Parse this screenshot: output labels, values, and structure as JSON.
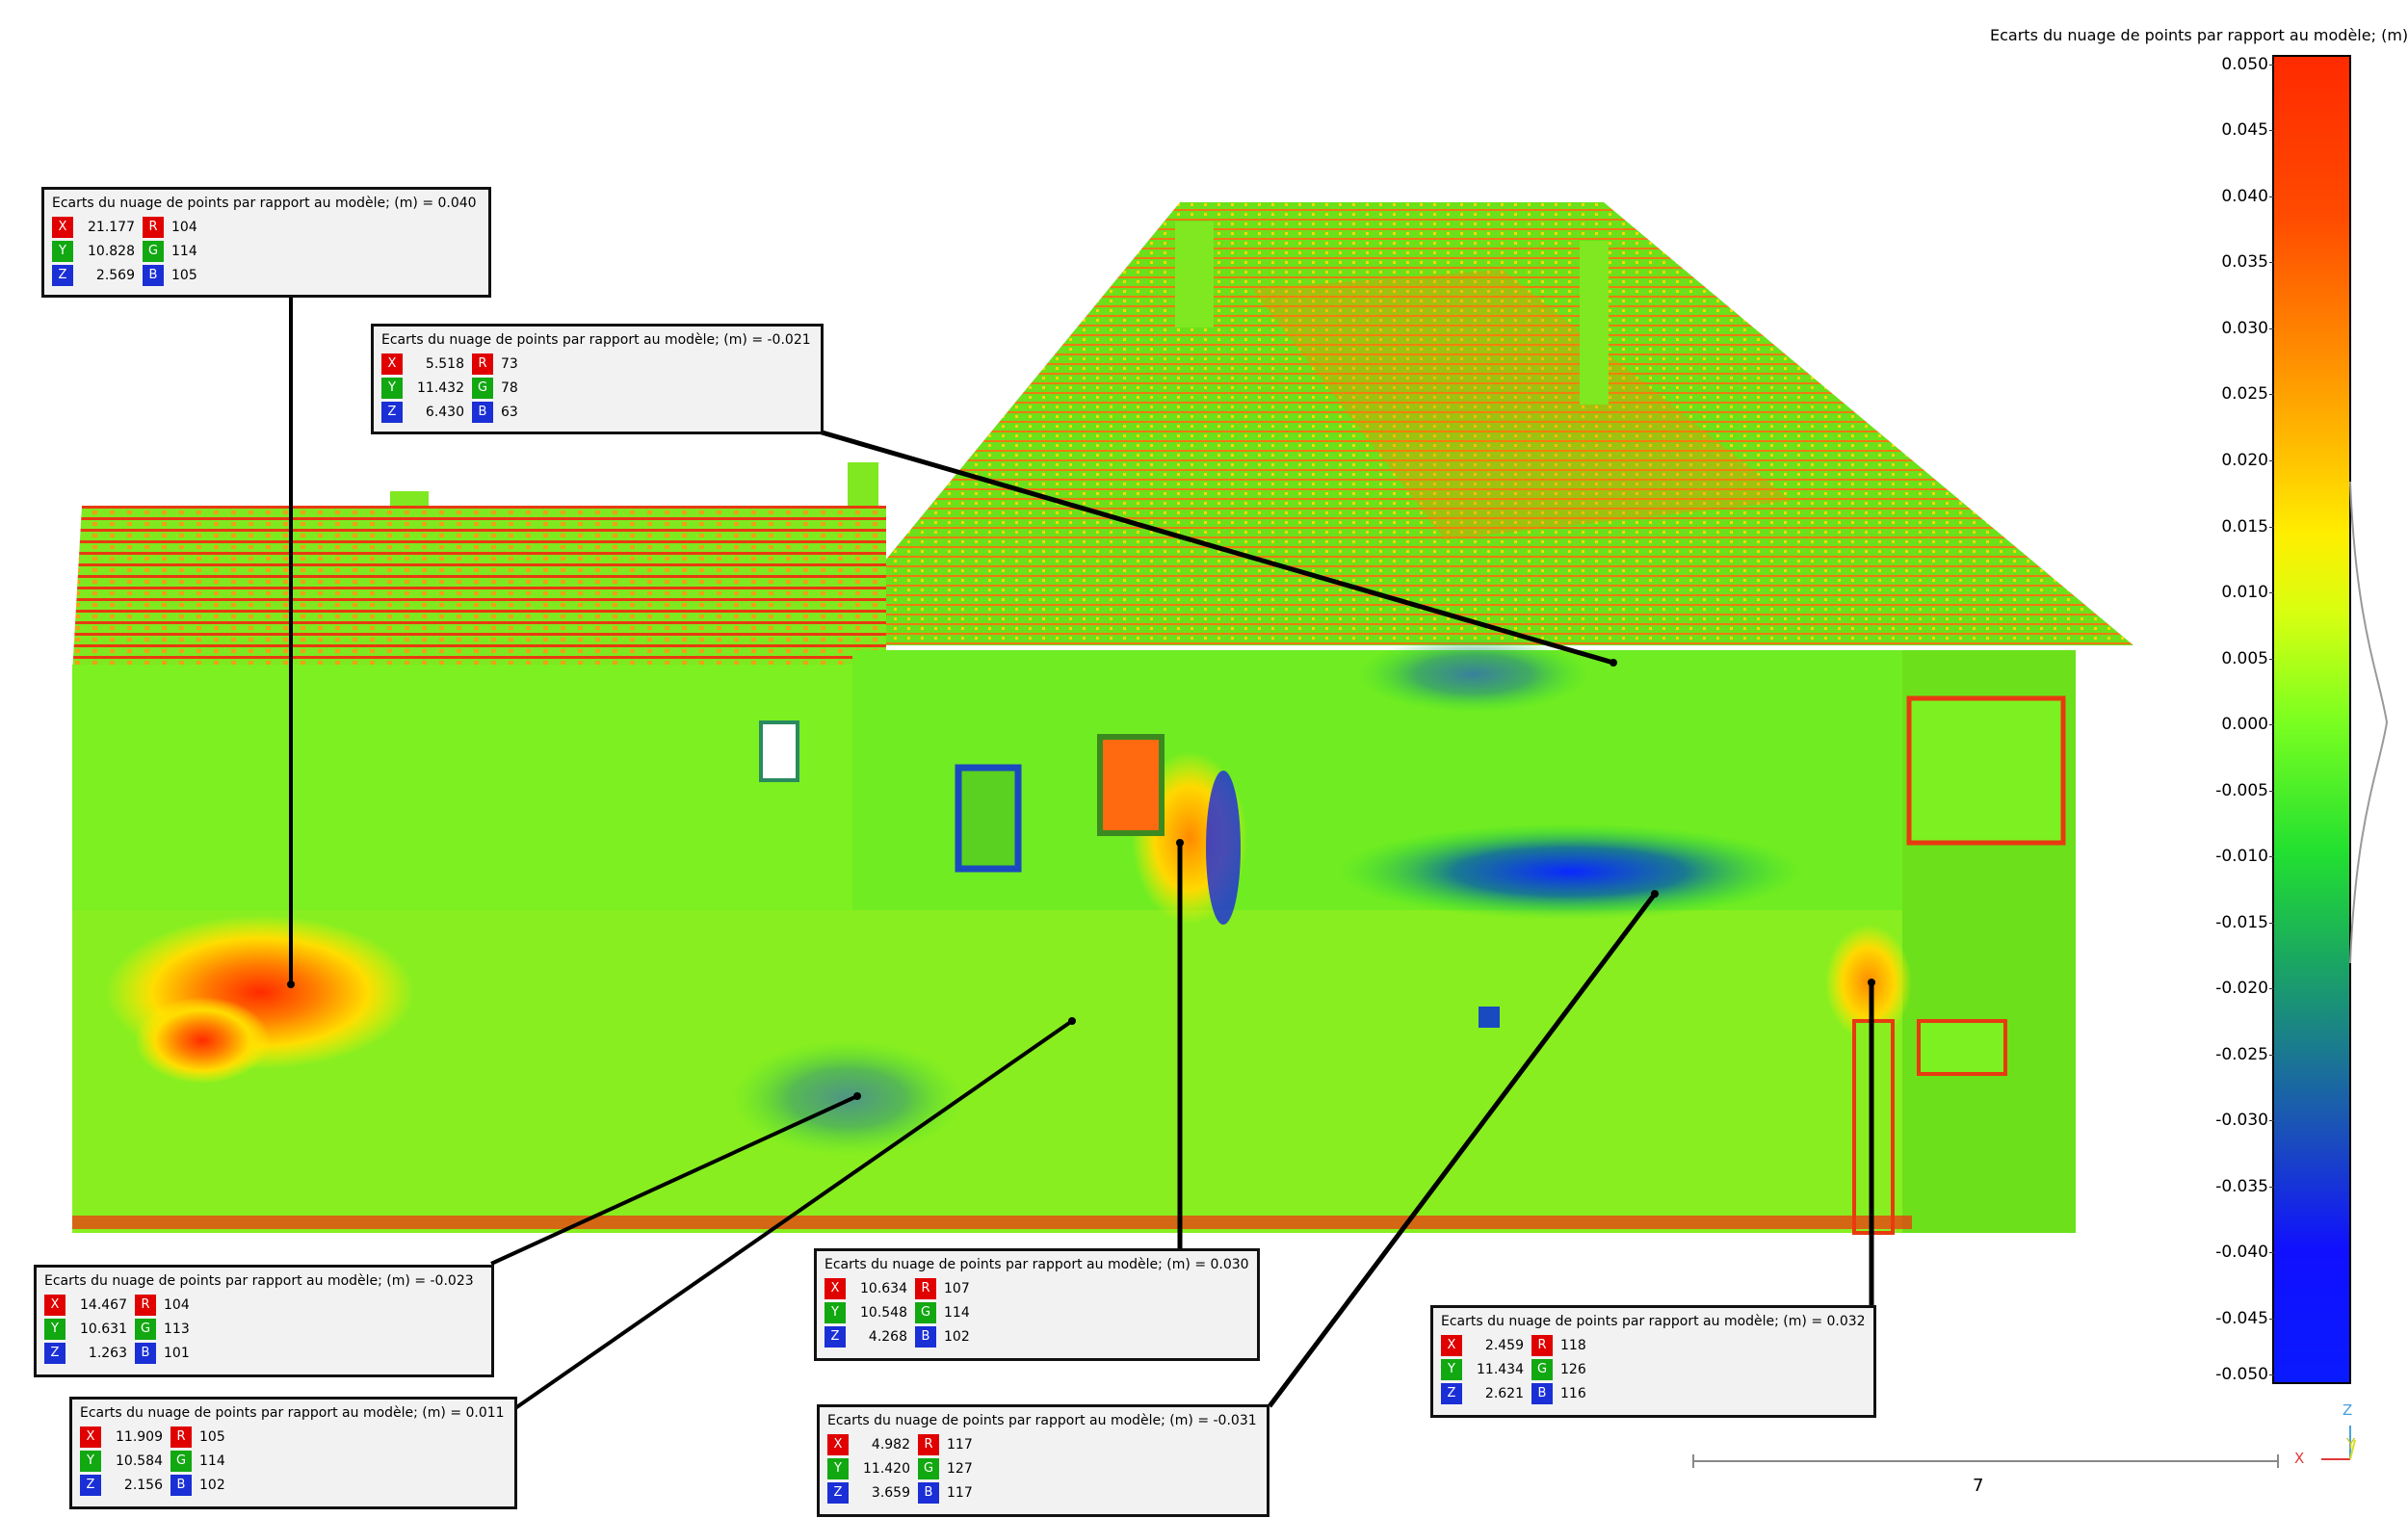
{
  "colorbar": {
    "title": "Ecarts du nuage de points par rapport au modèle; (m)",
    "ticks": [
      "0.050",
      "0.045",
      "0.040",
      "0.035",
      "0.030",
      "0.025",
      "0.020",
      "0.015",
      "0.010",
      "0.005",
      "0.000",
      "-0.005",
      "-0.010",
      "-0.015",
      "-0.020",
      "-0.025",
      "-0.030",
      "-0.035",
      "-0.040",
      "-0.045",
      "-0.050"
    ],
    "range": [
      -0.05,
      0.05
    ]
  },
  "labels": [
    {
      "title": "Ecarts du nuage de points par rapport au modèle; (m) = 0.040",
      "x": "21.177",
      "y": "10.828",
      "z": "2.569",
      "r": "104",
      "g": "114",
      "b": "105"
    },
    {
      "title": "Ecarts du nuage de points par rapport au modèle; (m) = -0.021",
      "x": "5.518",
      "y": "11.432",
      "z": "6.430",
      "r": "73",
      "g": "78",
      "b": "63"
    },
    {
      "title": "Ecarts du nuage de points par rapport au modèle; (m) = -0.023",
      "x": "14.467",
      "y": "10.631",
      "z": "1.263",
      "r": "104",
      "g": "113",
      "b": "101"
    },
    {
      "title": "Ecarts du nuage de points par rapport au modèle; (m) = 0.011",
      "x": "11.909",
      "y": "10.584",
      "z": "2.156",
      "r": "105",
      "g": "114",
      "b": "102"
    },
    {
      "title": "Ecarts du nuage de points par rapport au modèle; (m) = 0.030",
      "x": "10.634",
      "y": "10.548",
      "z": "4.268",
      "r": "107",
      "g": "114",
      "b": "102"
    },
    {
      "title": "Ecarts du nuage de points par rapport au modèle; (m) = -0.031",
      "x": "4.982",
      "y": "11.420",
      "z": "3.659",
      "r": "117",
      "g": "127",
      "b": "117"
    },
    {
      "title": "Ecarts du nuage de points par rapport au modèle; (m) = 0.032",
      "x": "2.459",
      "y": "11.434",
      "z": "2.621",
      "r": "118",
      "g": "126",
      "b": "116"
    }
  ],
  "badge_letters": {
    "x": "X",
    "y": "Y",
    "z": "Z",
    "r": "R",
    "g": "G",
    "b": "B"
  },
  "scale_bar": {
    "value": "7"
  },
  "axes": {
    "z": "Z",
    "y": "Y",
    "x": "X"
  },
  "colors": {
    "red": "#e00000",
    "green": "#12a812",
    "blue": "#1a2fd6",
    "label_bg": "#f2f2f2"
  }
}
